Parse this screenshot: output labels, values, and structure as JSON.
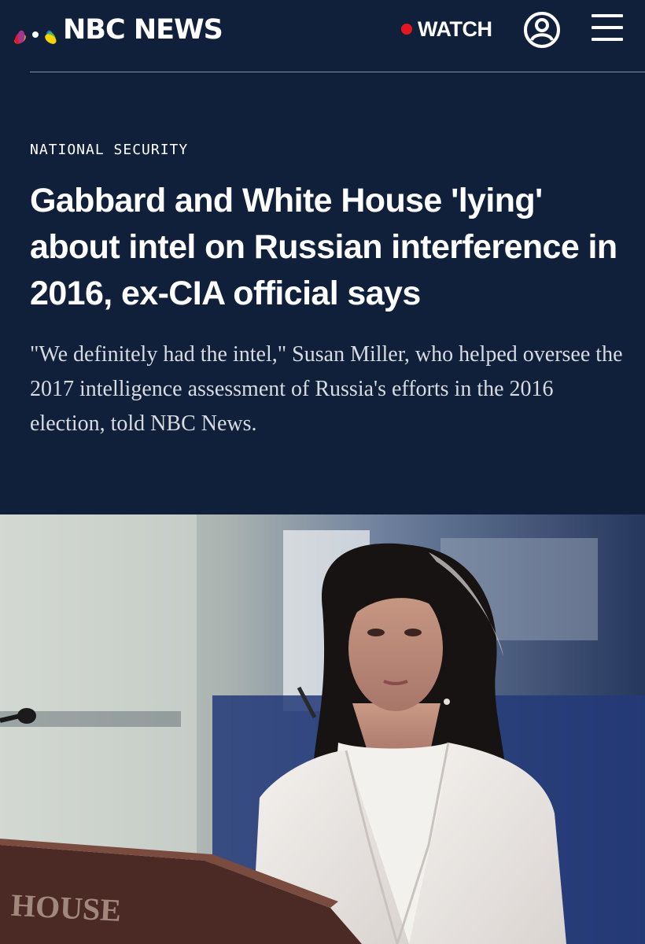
{
  "header": {
    "brand": "NBC NEWS",
    "watch_label": "WATCH",
    "logo_icon": "nbc-peacock-icon",
    "account_icon": "user-account-icon",
    "menu_icon": "hamburger-menu-icon"
  },
  "article": {
    "category": "NATIONAL SECURITY",
    "headline": "Gabbard and White House 'lying' about intel on Russian interference in 2016, ex-CIA official says",
    "dek": "\"We definitely had the intel,\" Susan Miller, who helped oversee the 2017 intelligence assessment of Russia's efforts in the 2016 election, told NBC News."
  },
  "photo": {
    "podium_text": "HOUSE"
  },
  "colors": {
    "background": "#11203a",
    "live_dot": "#e4161f",
    "text": "#ffffff"
  }
}
